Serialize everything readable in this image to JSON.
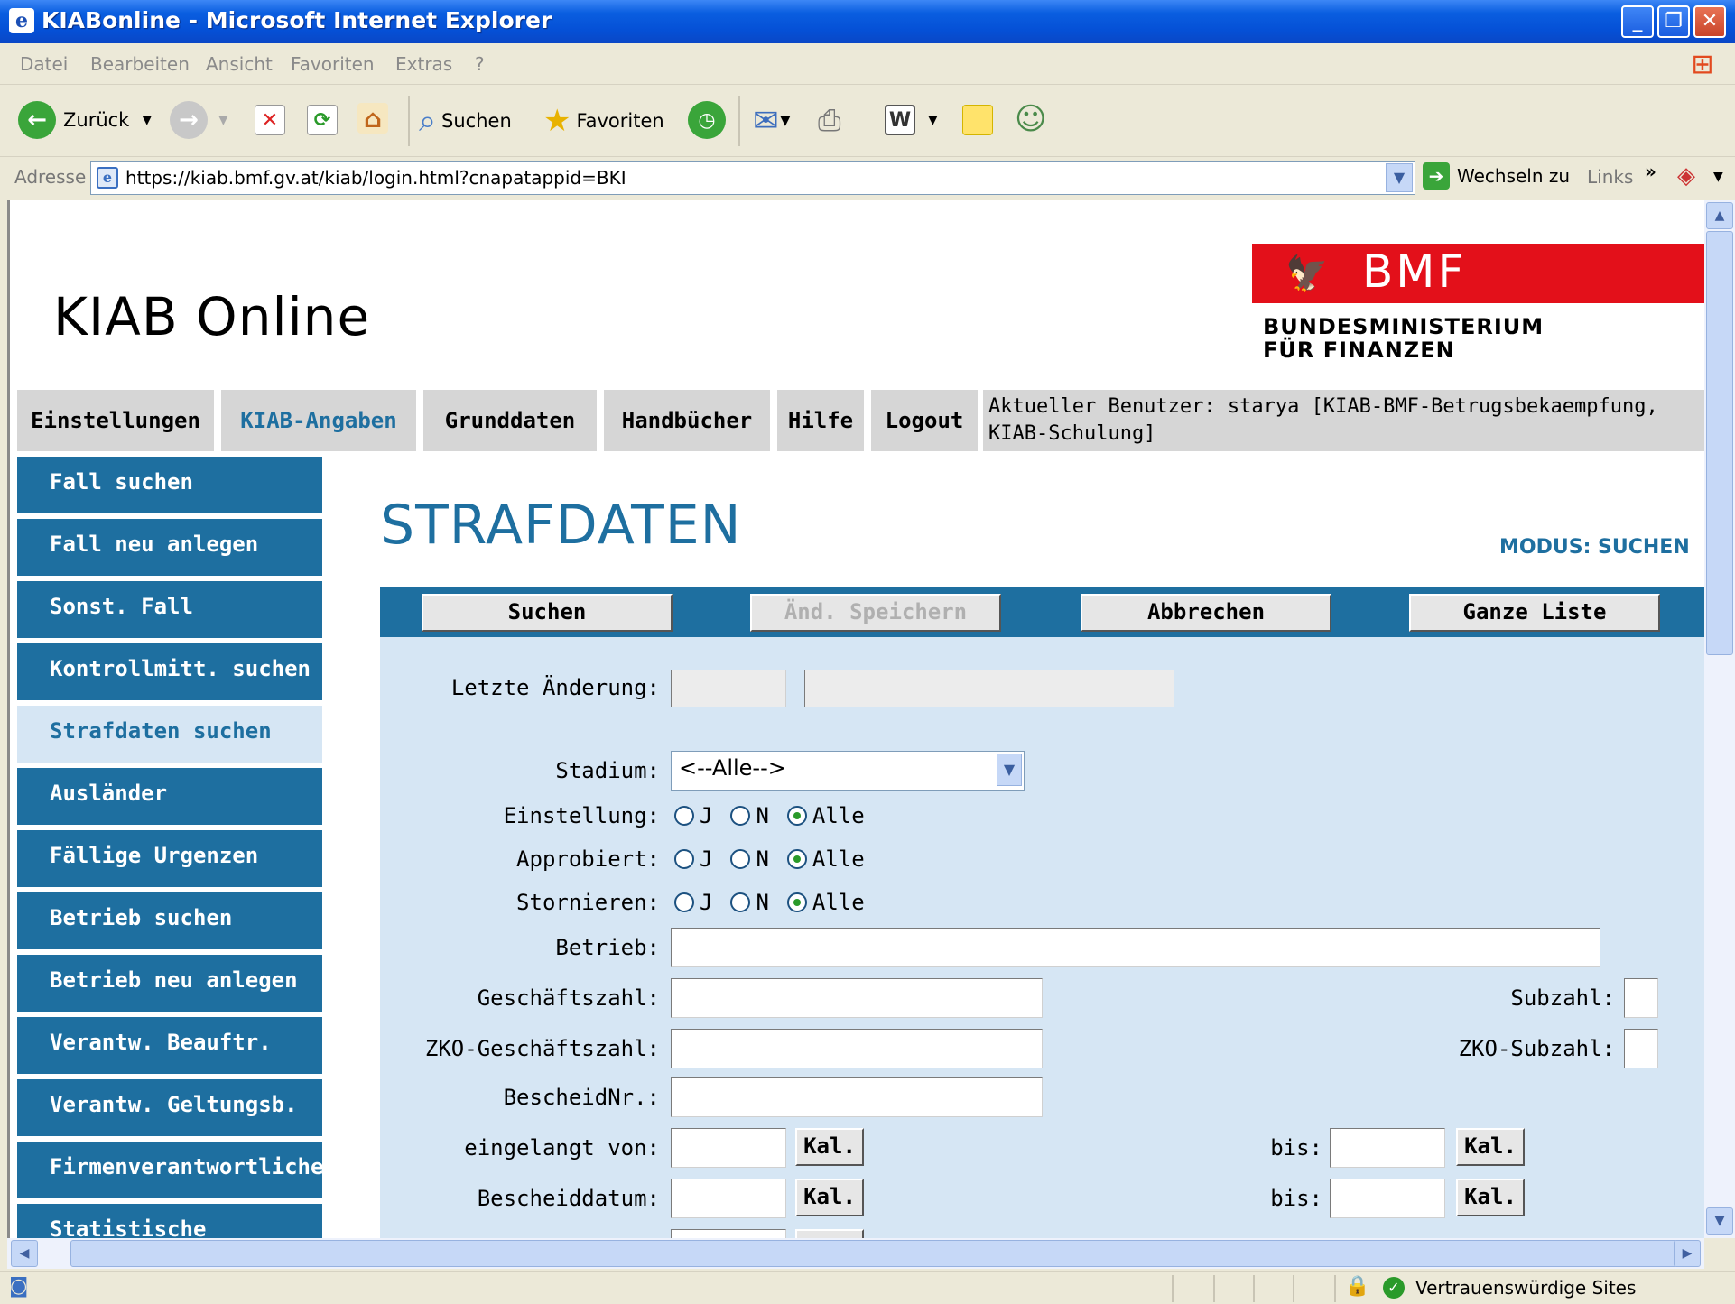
{
  "window": {
    "title": "KIABonline - Microsoft Internet Explorer"
  },
  "menu": [
    "Datei",
    "Bearbeiten",
    "Ansicht",
    "Favoriten",
    "Extras",
    "?"
  ],
  "toolbar": {
    "back": "Zurück",
    "search": "Suchen",
    "favorites": "Favoriten"
  },
  "address": {
    "label": "Adresse",
    "url": "https://kiab.bmf.gv.at/kiab/login.html?cnapatappid=BKI",
    "go": "Wechseln zu",
    "links": "Links"
  },
  "header": {
    "title": "KIAB Online",
    "logo_text": "BMF",
    "ministry_line1": "BUNDESMINISTERIUM",
    "ministry_line2": "FÜR FINANZEN"
  },
  "topnav": {
    "tabs": [
      "Einstellungen",
      "KIAB-Angaben",
      "Grunddaten",
      "Handbücher",
      "Hilfe",
      "Logout"
    ],
    "active": "KIAB-Angaben",
    "user": "Aktueller Benutzer: starya [KIAB-BMF-Betrugsbekaempfung, KIAB-Schulung]"
  },
  "leftnav": {
    "items": [
      "Fall suchen",
      "Fall neu anlegen",
      "Sonst. Fall",
      "Kontrollmitt. suchen",
      "Strafdaten suchen",
      "Ausländer",
      "Fällige Urgenzen",
      "Betrieb suchen",
      "Betrieb neu anlegen",
      "Verantw. Beauftr.",
      "Verantw. Geltungsb.",
      "Firmenverantwortlicher",
      "Statistische"
    ],
    "active": "Strafdaten suchen"
  },
  "main": {
    "title": "STRAFDATEN",
    "mode": "MODUS: SUCHEN",
    "buttons": [
      "Suchen",
      "Änd. Speichern",
      "Abbrechen",
      "Ganze Liste"
    ],
    "disabled_button": "Änd. Speichern"
  },
  "form": {
    "letzte_aenderung": "Letzte Änderung:",
    "stadium": "Stadium:",
    "stadium_value": "<--Alle-->",
    "einstellung": "Einstellung:",
    "approbiert": "Approbiert:",
    "stornieren": "Stornieren:",
    "radio_j": "J",
    "radio_n": "N",
    "radio_alle": "Alle",
    "betrieb": "Betrieb:",
    "geschaeftszahl": "Geschäftszahl:",
    "subzahl": "Subzahl:",
    "zko_geschaeftszahl": "ZKO-Geschäftszahl:",
    "zko_subzahl": "ZKO-Subzahl:",
    "bescheidnr": "BescheidNr.:",
    "eingelangt_von": "eingelangt von:",
    "bescheiddatum": "Bescheiddatum:",
    "bis": "bis:",
    "kal": "Kal."
  },
  "statusbar": {
    "zone": "Vertrauenswürdige Sites"
  },
  "colors": {
    "nav_blue": "#1e6fa0",
    "light_blue": "#d6e6f4",
    "tab_gray": "#d6d6d6",
    "bmf_red": "#e3101a"
  }
}
